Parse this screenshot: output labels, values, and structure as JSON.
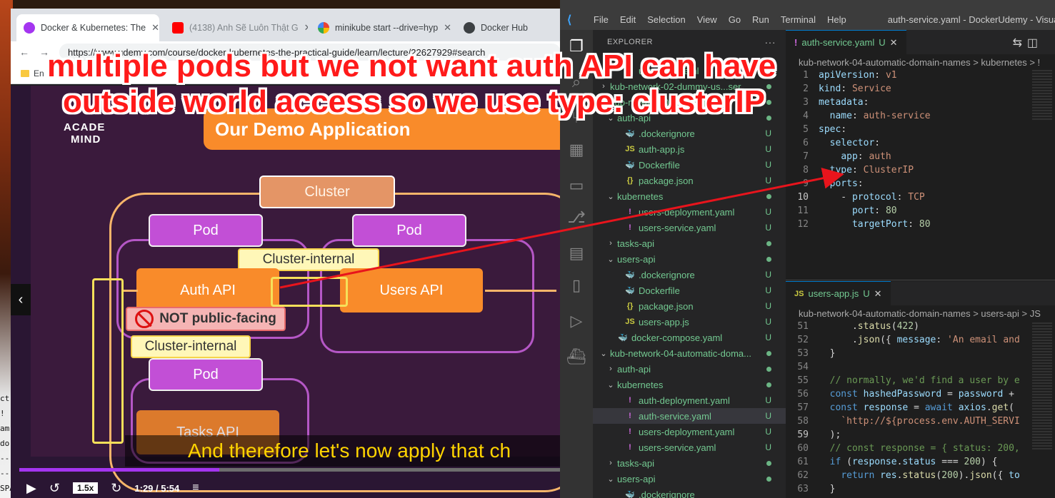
{
  "browser": {
    "tabs": [
      {
        "label": "Docker & Kubernetes: The",
        "color": "#a435f0"
      },
      {
        "label": "(4138) Anh Sẽ Luôn Thật G",
        "color": "#ff0000"
      },
      {
        "label": "minikube start --drive=hyp",
        "color": "#4285f4"
      },
      {
        "label": "Docker Hub",
        "color": "#5f6368"
      }
    ],
    "url": "https://www.udemy.com/course/docker-kubernetes-the-practical-guide/learn/lecture/22627929#search",
    "bookmark": "En"
  },
  "video": {
    "logo_line1": "ACADE",
    "logo_line2": "MIND",
    "slide_title": "Our Demo Application",
    "cluster_label": "Cluster",
    "pod_label": "Pod",
    "cluster_internal_label": "Cluster-internal",
    "auth_api": "Auth API",
    "users_api": "Users API",
    "tasks_api": "Tasks API",
    "not_public": "NOT public-facing",
    "caption": "And therefore let's now apply that ch",
    "speed": "1.5x",
    "time": "1:29 / 5:54",
    "progress_fraction": 0.37
  },
  "desktop": {
    "side_text": [
      "ct A",
      "!",
      "am",
      "dor",
      "---",
      "---",
      "SPA"
    ]
  },
  "vscode": {
    "menu": [
      "File",
      "Edit",
      "Selection",
      "View",
      "Go",
      "Run",
      "Terminal",
      "Help"
    ],
    "window_title": "auth-service.yaml - DockerUdemy - Visual Studio",
    "explorer_label": "EXPLORER",
    "explorer_more": "···",
    "tree": [
      {
        "label": "users-api.yaml",
        "indent": 2,
        "kind": "yaml",
        "status": "U",
        "twist": ""
      },
      {
        "label": "kub-network-02-dummy-us...ser",
        "indent": 0,
        "kind": "folder",
        "status": "dot",
        "twist": ">"
      },
      {
        "label": "kub-network-03-auth-api",
        "indent": 0,
        "kind": "folder",
        "status": "dot",
        "twist": "v"
      },
      {
        "label": "auth-api",
        "indent": 1,
        "kind": "folder",
        "status": "dot",
        "twist": "v"
      },
      {
        "label": ".dockerignore",
        "indent": 2,
        "kind": "docker",
        "status": "U",
        "twist": ""
      },
      {
        "label": "auth-app.js",
        "indent": 2,
        "kind": "js",
        "status": "U",
        "twist": ""
      },
      {
        "label": "Dockerfile",
        "indent": 2,
        "kind": "docker",
        "status": "U",
        "twist": ""
      },
      {
        "label": "package.json",
        "indent": 2,
        "kind": "json",
        "status": "U",
        "twist": ""
      },
      {
        "label": "kubernetes",
        "indent": 1,
        "kind": "folder",
        "status": "dot",
        "twist": "v"
      },
      {
        "label": "users-deployment.yaml",
        "indent": 2,
        "kind": "yaml",
        "status": "U",
        "twist": ""
      },
      {
        "label": "users-service.yaml",
        "indent": 2,
        "kind": "yaml",
        "status": "U",
        "twist": ""
      },
      {
        "label": "tasks-api",
        "indent": 1,
        "kind": "folder",
        "status": "dot",
        "twist": ">"
      },
      {
        "label": "users-api",
        "indent": 1,
        "kind": "folder",
        "status": "dot",
        "twist": "v"
      },
      {
        "label": ".dockerignore",
        "indent": 2,
        "kind": "docker",
        "status": "U",
        "twist": ""
      },
      {
        "label": "Dockerfile",
        "indent": 2,
        "kind": "docker",
        "status": "U",
        "twist": ""
      },
      {
        "label": "package.json",
        "indent": 2,
        "kind": "json",
        "status": "U",
        "twist": ""
      },
      {
        "label": "users-app.js",
        "indent": 2,
        "kind": "js",
        "status": "U",
        "twist": ""
      },
      {
        "label": "docker-compose.yaml",
        "indent": 1,
        "kind": "docker",
        "status": "U",
        "twist": ""
      },
      {
        "label": "kub-network-04-automatic-doma...",
        "indent": 0,
        "kind": "folder",
        "status": "dot",
        "twist": "v"
      },
      {
        "label": "auth-api",
        "indent": 1,
        "kind": "folder",
        "status": "dot",
        "twist": ">"
      },
      {
        "label": "kubernetes",
        "indent": 1,
        "kind": "folder",
        "status": "dot",
        "twist": "v"
      },
      {
        "label": "auth-deployment.yaml",
        "indent": 2,
        "kind": "yaml",
        "status": "U",
        "twist": ""
      },
      {
        "label": "auth-service.yaml",
        "indent": 2,
        "kind": "yaml",
        "status": "U",
        "twist": "",
        "selected": true
      },
      {
        "label": "users-deployment.yaml",
        "indent": 2,
        "kind": "yaml",
        "status": "U",
        "twist": ""
      },
      {
        "label": "users-service.yaml",
        "indent": 2,
        "kind": "yaml",
        "status": "U",
        "twist": ""
      },
      {
        "label": "tasks-api",
        "indent": 1,
        "kind": "folder",
        "status": "dot",
        "twist": ">"
      },
      {
        "label": "users-api",
        "indent": 1,
        "kind": "folder",
        "status": "dot",
        "twist": "v"
      },
      {
        "label": ".dockerignore",
        "indent": 2,
        "kind": "docker",
        "status": "",
        "twist": ""
      }
    ],
    "top_editor": {
      "tab": "auth-service.yaml",
      "tab_status": "U",
      "breadcrumb": "kub-network-04-automatic-domain-names > kubernetes > !",
      "lines": [
        {
          "n": "1",
          "html": "<span class='pv'>apiVersion</span>: <span class='v'>v1</span>"
        },
        {
          "n": "2",
          "html": "<span class='pv'>kind</span>: <span class='v'>Service</span>"
        },
        {
          "n": "3",
          "html": "<span class='pv'>metadata</span>:"
        },
        {
          "n": "4",
          "html": "  <span class='pv'>name</span>: <span class='v'>auth-service</span>"
        },
        {
          "n": "5",
          "html": "<span class='pv'>spec</span>:"
        },
        {
          "n": "6",
          "html": "  <span class='pv'>selector</span>:"
        },
        {
          "n": "7",
          "html": "    <span class='pv'>app</span>: <span class='v'>auth</span>"
        },
        {
          "n": "8",
          "html": "  <span class='pv'>type</span>: <span class='v'>ClusterIP</span>"
        },
        {
          "n": "9",
          "html": "  <span class='pv'>ports</span>:"
        },
        {
          "n": "10",
          "html": "    - <span class='pv'>protocol</span>: <span class='v'>TCP</span>",
          "current": true
        },
        {
          "n": "11",
          "html": "      <span class='pv'>port</span>: <span class='n'>80</span>"
        },
        {
          "n": "12",
          "html": "      <span class='pv'>targetPort</span>: <span class='n'>80</span>"
        }
      ]
    },
    "bottom_editor": {
      "tab": "users-app.js",
      "tab_status": "U",
      "breadcrumb": "kub-network-04-automatic-domain-names > users-api > JS",
      "lines": [
        {
          "n": "51",
          "html": "      .<span class='f'>status</span>(<span class='n'>422</span>)"
        },
        {
          "n": "52",
          "html": "      .<span class='f'>json</span>({ <span class='pv'>message</span>: <span class='v'>'An email and</span>"
        },
        {
          "n": "53",
          "html": "  }"
        },
        {
          "n": "54",
          "html": ""
        },
        {
          "n": "55",
          "html": "  <span class='cm'>// normally, we'd find a user by e</span>"
        },
        {
          "n": "56",
          "html": "  <span class='k'>const</span> <span class='pv'>hashedPassword</span> = <span class='pv'>password</span> +"
        },
        {
          "n": "57",
          "html": "  <span class='k'>const</span> <span class='pv'>response</span> = <span class='k'>await</span> <span class='pv'>axios</span>.<span class='f'>get</span>("
        },
        {
          "n": "58",
          "html": "    <span class='v'>`http://${process.env.AUTH_SERVI</span>"
        },
        {
          "n": "59",
          "html": "  );",
          "current": true
        },
        {
          "n": "60",
          "html": "  <span class='cm'>// const response = { status: 200,</span>"
        },
        {
          "n": "61",
          "html": "  <span class='k'>if</span> (<span class='pv'>response</span>.<span class='pv'>status</span> === <span class='n'>200</span>) {"
        },
        {
          "n": "62",
          "html": "    <span class='k'>return</span> <span class='pv'>res</span>.<span class='f'>status</span>(<span class='n'>200</span>).<span class='f'>json</span>({ <span class='pv'>to</span>"
        },
        {
          "n": "63",
          "html": "  }"
        }
      ]
    }
  },
  "annotation": {
    "line1": "multiple pods but we not want auth API can have",
    "line2": "outside world access so we use type: clusterIP",
    "color": "#ff1a1a"
  }
}
